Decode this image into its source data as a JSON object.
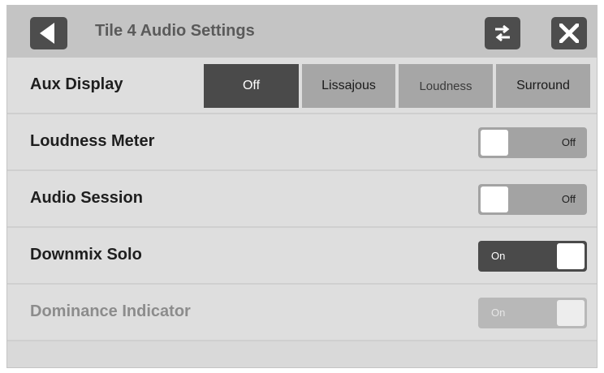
{
  "header": {
    "title": "Tile 4 Audio Settings",
    "back_icon": "back-triangle-icon",
    "swap_icon": "swap-arrows-icon",
    "close_icon": "close-x-icon"
  },
  "aux_display": {
    "label": "Aux Display",
    "options": [
      "Off",
      "Lissajous",
      "Loudness",
      "Surround"
    ],
    "selected": "Off"
  },
  "settings": [
    {
      "label": "Loudness Meter",
      "state": "Off",
      "enabled": true
    },
    {
      "label": "Audio Session",
      "state": "Off",
      "enabled": true
    },
    {
      "label": "Downmix Solo",
      "state": "On",
      "enabled": true
    },
    {
      "label": "Dominance Indicator",
      "state": "On",
      "enabled": false
    }
  ],
  "colors": {
    "panel": "#d9d9d9",
    "header": "#c4c4c4",
    "active": "#4a4a4a",
    "inactive": "#a6a6a6"
  }
}
